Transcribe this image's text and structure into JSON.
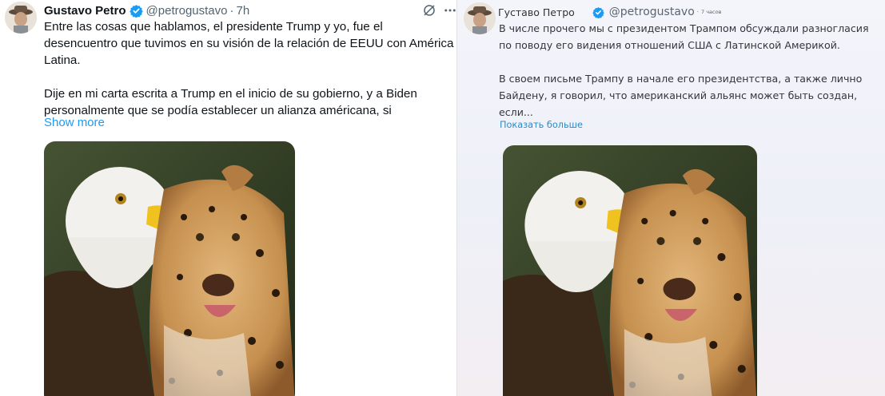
{
  "original_tweet": {
    "author_name": "Gustavo Petro",
    "handle": "@petrogustavo",
    "time": "7h",
    "paragraph1": "Entre las cosas que hablamos, el presidente Trump y yo, fue el desencuentro que tuvimos en su visión de la relación de EEUU con América Latina.",
    "paragraph2": "Dije en mi carta escrita a Trump en el inicio de su gobierno, y a Biden personalmente que se podía establecer un alianza américana, si",
    "show_more": "Show more",
    "icons": [
      "verified-badge-icon",
      "grok-icon",
      "more-icon"
    ]
  },
  "translated_tweet": {
    "author_name": "Густаво Петро",
    "handle": "@petrogustavo",
    "time": "7 часов",
    "paragraph1": "В числе прочего мы с президентом Трампом обсуждали разногласия по поводу его видения отношений США с Латинской Америкой.",
    "paragraph2": "В своем письме Трампу в начале его президентства, а также лично Байдену, я говорил, что американский альянс может быть создан, если...",
    "show_more": "Показать больше",
    "icons": [
      "verified-badge-icon"
    ]
  },
  "colors": {
    "link_blue": "#1d9bf0",
    "verified_blue": "#1d9bf0",
    "secondary_text": "#536471"
  }
}
